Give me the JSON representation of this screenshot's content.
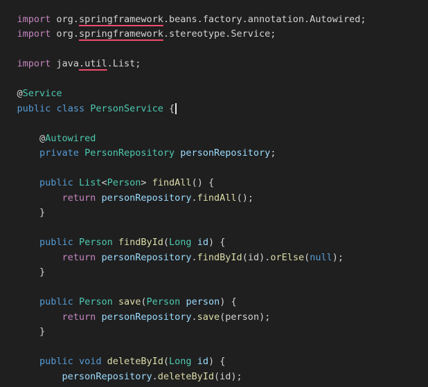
{
  "lines": [
    [
      "import",
      " org.",
      "springframework",
      ".beans.factory.annotation.Autowired;"
    ],
    [
      "import",
      " org.",
      "springframework",
      ".stereotype.Service;"
    ],
    [],
    [
      "import",
      " java",
      ".util",
      ".List;"
    ],
    [],
    [
      "@",
      "Service"
    ],
    [
      "public",
      " ",
      "class",
      " ",
      "PersonService",
      " {"
    ],
    [],
    [
      "    ",
      "@",
      "Autowired"
    ],
    [
      "    ",
      "private",
      " ",
      "PersonRepository",
      " ",
      "personRepository",
      ";"
    ],
    [],
    [
      "    ",
      "public",
      " ",
      "List",
      "<",
      "Person",
      "> ",
      "findAll",
      "() {"
    ],
    [
      "        ",
      "return",
      " ",
      "personRepository",
      ".",
      "findAll",
      "();"
    ],
    [
      "    ",
      "}"
    ],
    [],
    [
      "    ",
      "public",
      " ",
      "Person",
      " ",
      "findById",
      "(",
      "Long",
      " ",
      "id",
      ") {"
    ],
    [
      "        ",
      "return",
      " ",
      "personRepository",
      ".",
      "findById",
      "(id).",
      "orElse",
      "(",
      "null",
      ");"
    ],
    [
      "    ",
      "}"
    ],
    [],
    [
      "    ",
      "public",
      " ",
      "Person",
      " ",
      "save",
      "(",
      "Person",
      " ",
      "person",
      ") {"
    ],
    [
      "        ",
      "return",
      " ",
      "personRepository",
      ".",
      "save",
      "(person);"
    ],
    [
      "    ",
      "}"
    ],
    [],
    [
      "    ",
      "public",
      " ",
      "void",
      " ",
      "deleteById",
      "(",
      "Long",
      " ",
      "id",
      ") {"
    ],
    [
      "        ",
      "personRepository",
      ".",
      "deleteById",
      "(id);"
    ],
    [
      "    ",
      "}"
    ]
  ],
  "theme": {
    "background": "#1f1f1f",
    "keyword": "#569cd6",
    "type": "#4ec9b0",
    "function": "#dcdcaa",
    "variable": "#9cdcfe",
    "text": "#d4d4d4",
    "error_squiggle": "#f14c6c"
  }
}
